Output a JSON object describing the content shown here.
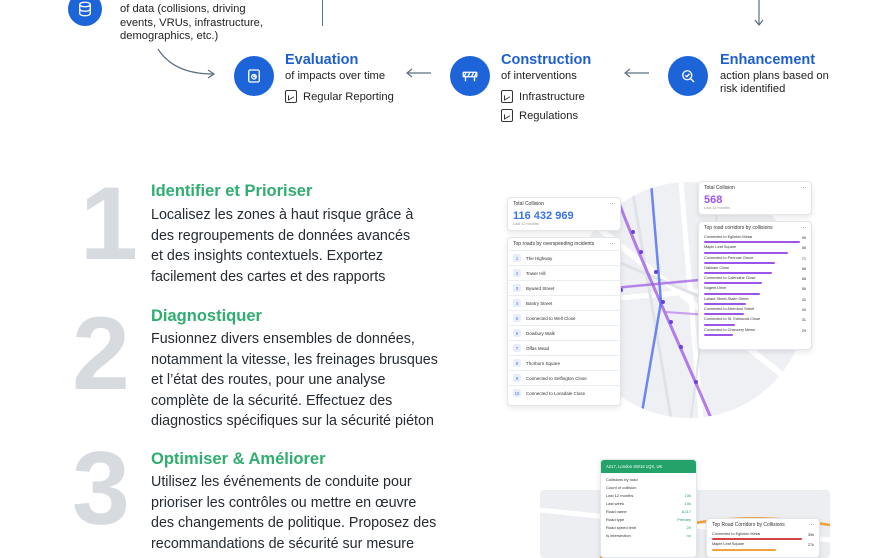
{
  "intro": {
    "lines": [
      "of data (collisions, driving",
      "events, VRUs, infrastructure,",
      "demographics, etc.)"
    ]
  },
  "process": {
    "evaluation": {
      "title": "Evaluation",
      "subtitle": "of impacts over time",
      "items": [
        "Regular Reporting"
      ]
    },
    "construction": {
      "title": "Construction",
      "subtitle": "of interventions",
      "items": [
        "Infrastructure",
        "Regulations"
      ]
    },
    "enhancement": {
      "title": "Enhancement",
      "subtitle_lines": [
        "action plans based on",
        "risk identified"
      ]
    }
  },
  "steps": [
    {
      "number": "1",
      "title": "Identifier et Prioriser",
      "body_lines": [
        "Localisez les zones à haut risque grâce à",
        "des regroupements de données avancés",
        "et des insights contextuels. Exportez",
        "facilement des cartes et des rapports"
      ]
    },
    {
      "number": "2",
      "title": "Diagnostiquer",
      "body_lines": [
        "Fusionnez divers ensembles de données,",
        "notamment la vitesse, les freinages brusques",
        "et l’état des routes, pour une analyse",
        "complète de la sécurité. Effectuez des",
        "diagnostics spécifiques sur la sécurité piéton"
      ]
    },
    {
      "number": "3",
      "title": "Optimiser & Améliorer",
      "body_lines": [
        "Utilisez les événements de conduite pour",
        "prioriser les contrôles ou mettre en œuvre",
        "des changements de politique. Proposez des",
        "recommandations de sécurité sur mesure"
      ]
    }
  ],
  "dashboard": {
    "total_card": {
      "label": "Total Collision",
      "value": "116 432 969",
      "period": "Last 12 months"
    },
    "top_roads": {
      "label": "Top roads by overspeeding incidents",
      "rows": [
        "The Highway",
        "Tower Hill",
        "Byward Street",
        "Bantry Street",
        "Connected to Well Close",
        "Dowbury Walk",
        "Offas Mead",
        "Thorburn Square",
        "Connected to Selfington Close",
        "Connected to Lonsdale Close"
      ]
    },
    "total_card_2": {
      "label": "Total Collision",
      "value": "568",
      "period": "Last 12 months"
    },
    "corridors": {
      "label": "Top road corridors by collisions",
      "rows": [
        {
          "name": "Connected to Eglinton Mews",
          "value": "96"
        },
        {
          "name": "Maple Leaf Square",
          "value": "85"
        },
        {
          "name": "Connected to Penrose Grove",
          "value": "71"
        },
        {
          "name": "Oakham Close",
          "value": "68"
        },
        {
          "name": "Connected to Calendine Close",
          "value": "58"
        },
        {
          "name": "Nugent Drive",
          "value": "56"
        },
        {
          "name": "Lollard Street-Stalin Street",
          "value": "42"
        },
        {
          "name": "Connected to Aberdour Street",
          "value": "40"
        },
        {
          "name": "Connected to St. Edmunds Close",
          "value": "31"
        },
        {
          "name": "Connected to Chancery Mews",
          "value": "29"
        }
      ]
    },
    "corridor_levels": [
      1.0,
      0.88,
      0.74,
      0.71,
      0.6,
      0.58,
      0.44,
      0.42,
      0.32,
      0.3
    ],
    "road_panel": {
      "header": "A217, London SW16 1QX, UK",
      "section": "Collisions by road",
      "count_label": "Count of collision",
      "rows": [
        {
          "label": "Last 12 months",
          "value": "10k"
        },
        {
          "label": "Last week",
          "value": "10k"
        },
        {
          "label": "Road name",
          "value": "A217"
        },
        {
          "label": "Road type",
          "value": "Primary"
        },
        {
          "label": "Road speed limit",
          "value": "20"
        },
        {
          "label": "Is intersection",
          "value": "no"
        }
      ]
    },
    "bottom_corridors": {
      "label": "Top Road Corridors by Collisions",
      "rows": [
        {
          "name": "Connected to Eglinton Mews",
          "value": "39k"
        },
        {
          "name": "Maple Leaf Square",
          "value": "27k"
        }
      ]
    }
  },
  "colors": {
    "accent_blue": "#1d5fd0",
    "accent_green": "#2fae6f",
    "purple": "#9c55e6"
  }
}
